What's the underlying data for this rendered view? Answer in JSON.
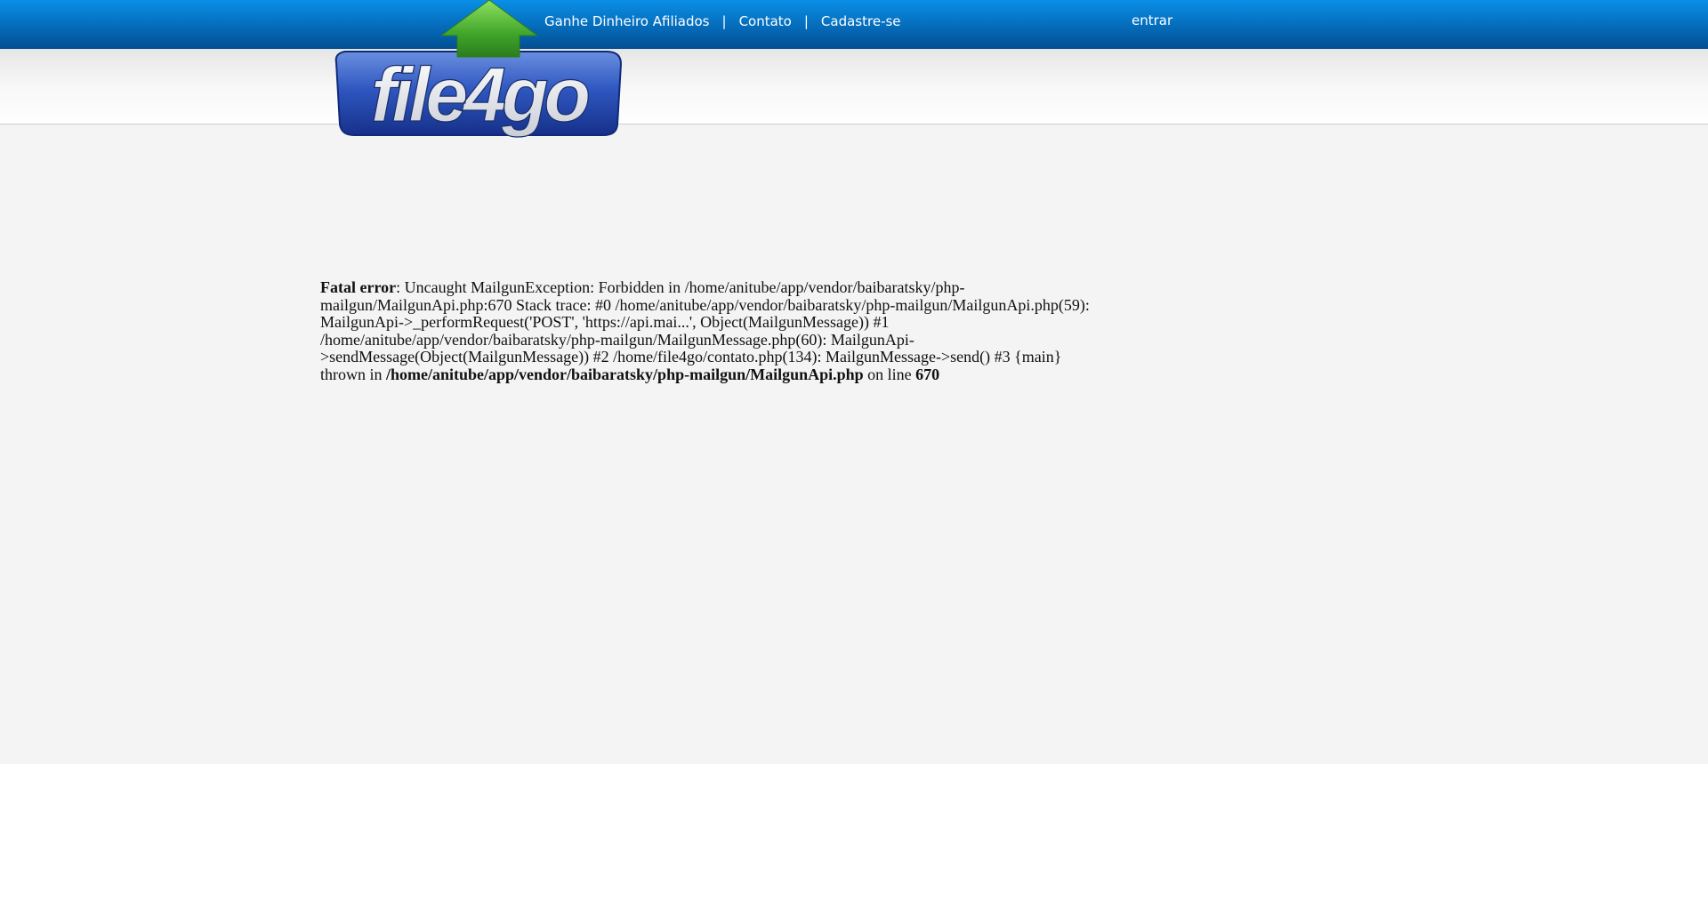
{
  "header": {
    "nav": [
      {
        "label": "Ganhe Dinheiro Afiliados"
      },
      {
        "label": "Contato"
      },
      {
        "label": "Cadastre-se"
      }
    ],
    "separator": "|",
    "login_label": "entrar"
  },
  "logo": {
    "text": "file4go",
    "colors": {
      "badge": "#2a4fb0",
      "arrow": "#4caf2a"
    }
  },
  "error": {
    "label": "Fatal error",
    "message": ": Uncaught MailgunException: Forbidden in /home/anitube/app/vendor/baibaratsky/php-mailgun/MailgunApi.php:670 Stack trace: #0 /home/anitube/app/vendor/baibaratsky/php-mailgun/MailgunApi.php(59): MailgunApi->_performRequest('POST', 'https://api.mai...', Object(MailgunMessage)) #1 /home/anitube/app/vendor/baibaratsky/php-mailgun/MailgunMessage.php(60): MailgunApi->sendMessage(Object(MailgunMessage)) #2 /home/file4go/contato.php(134): MailgunMessage->send() #3 {main} thrown in ",
    "file": "/home/anitube/app/vendor/baibaratsky/php-mailgun/MailgunApi.php",
    "on_line": " on line ",
    "line": "670"
  }
}
